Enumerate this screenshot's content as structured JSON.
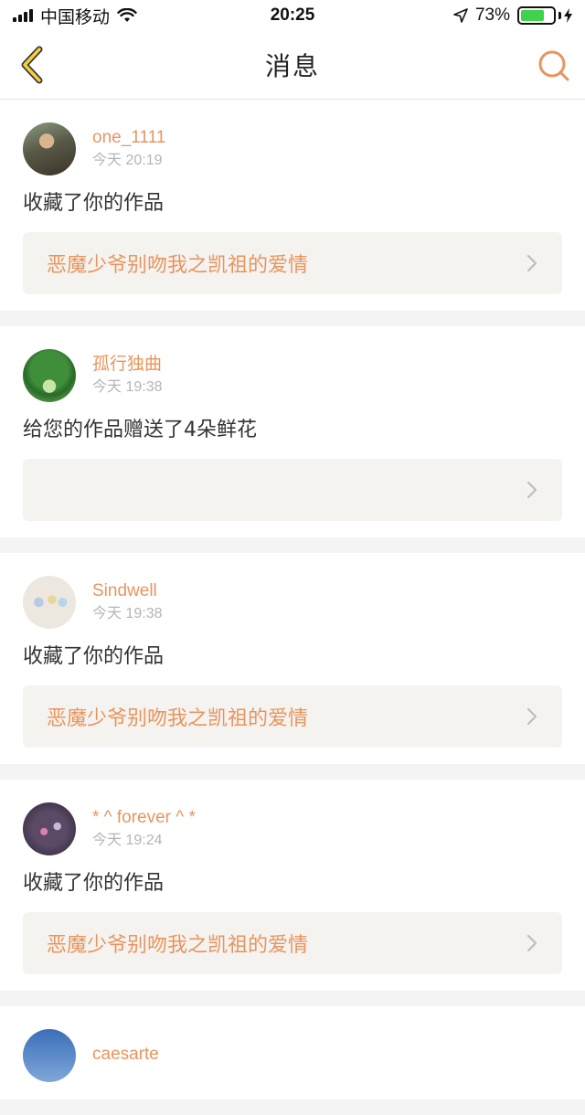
{
  "status_bar": {
    "carrier": "中国移动",
    "time": "20:25",
    "battery_percent": "73%",
    "battery_level": 0.73,
    "battery_color": "#3fd24a"
  },
  "nav": {
    "title": "消息",
    "back_icon": "chevron-left-icon",
    "search_icon": "search-icon",
    "accent_color": "#e8955f"
  },
  "messages": [
    {
      "username": "one_1111",
      "time": "今天 20:19",
      "action": "收藏了你的作品",
      "work_title": "恶魔少爷别吻我之凯祖的爱情"
    },
    {
      "username": "孤行独曲",
      "time": "今天 19:38",
      "action": "给您的作品赠送了4朵鲜花",
      "work_title": ""
    },
    {
      "username": "Sindwell",
      "time": "今天 19:38",
      "action": "收藏了你的作品",
      "work_title": "恶魔少爷别吻我之凯祖的爱情"
    },
    {
      "username": "* ^ forever ^ *",
      "time": "今天 19:24",
      "action": "收藏了你的作品",
      "work_title": "恶魔少爷别吻我之凯祖的爱情"
    },
    {
      "username": "caesarte",
      "time": "",
      "action": "",
      "work_title": ""
    }
  ]
}
